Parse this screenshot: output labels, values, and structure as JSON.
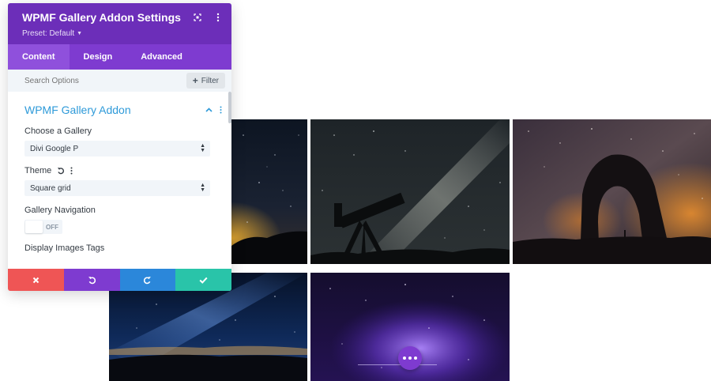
{
  "panel": {
    "title": "WPMF Gallery Addon Settings",
    "preset": "Preset: Default",
    "tabs": [
      {
        "label": "Content",
        "active": true
      },
      {
        "label": "Design",
        "active": false
      },
      {
        "label": "Advanced",
        "active": false
      }
    ],
    "search_placeholder": "Search Options",
    "filter_label": "Filter",
    "section_title": "WPMF Gallery Addon",
    "fields": {
      "gallery_label": "Choose a Gallery",
      "gallery_value": "Divi Google P",
      "theme_label": "Theme",
      "theme_value": "Square grid",
      "nav_label": "Gallery Navigation",
      "nav_toggle": "OFF",
      "tags_label": "Display Images Tags"
    }
  },
  "colors": {
    "header": "#6c2eb9",
    "tabs": "#7e3bd0",
    "section_title": "#2e9ad9",
    "cancel": "#ef5555",
    "undo": "#7e3bd0",
    "redo": "#2b87da",
    "save": "#29c4a9"
  },
  "gallery": {
    "images": [
      {
        "name": "night-sky-horizon"
      },
      {
        "name": "telescope-milky-way"
      },
      {
        "name": "delicate-arch-milky-way"
      },
      {
        "name": "blue-starry-night"
      },
      {
        "name": "purple-galaxy"
      }
    ]
  },
  "icons": [
    "screen-icon",
    "kebab-menu-icon",
    "plus-icon",
    "chevron-up-icon",
    "reset-icon",
    "cancel-x-icon",
    "undo-icon",
    "redo-icon",
    "checkmark-icon",
    "more-dots-icon"
  ]
}
